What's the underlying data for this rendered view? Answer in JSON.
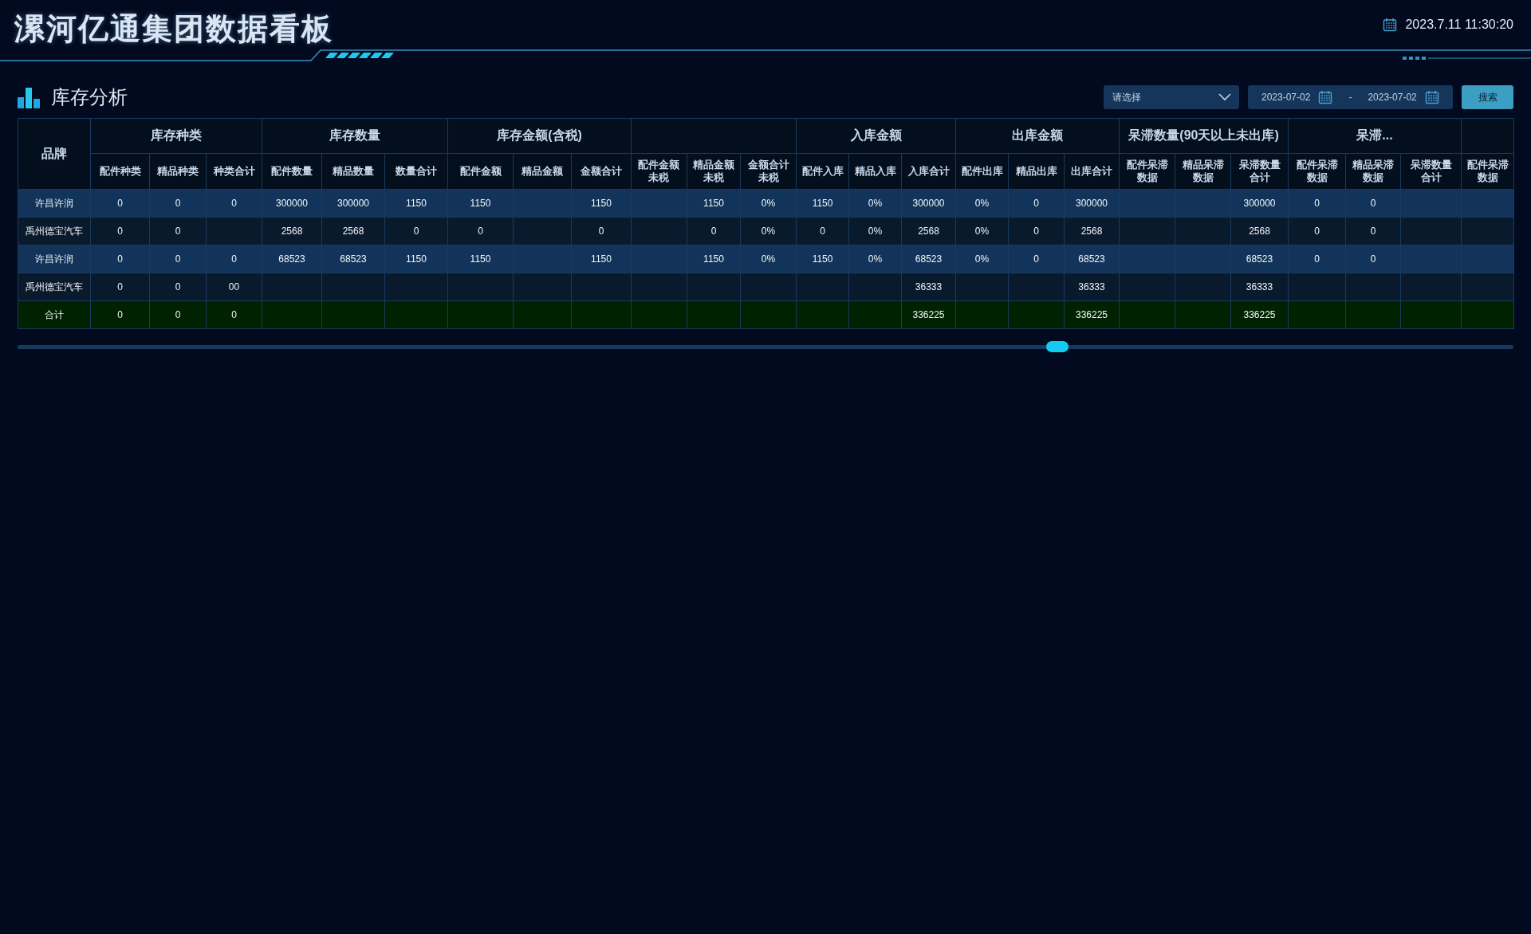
{
  "header": {
    "title": "漯河亿通集团数据看板",
    "datetime": "2023.7.11 11:30:20"
  },
  "section": {
    "title": "库存分析"
  },
  "filters": {
    "select": {
      "placeholder": "请选择"
    },
    "date_start": "2023-07-02",
    "date_separator": "-",
    "date_end": "2023-07-02",
    "search_button": "搜索"
  },
  "table": {
    "brand_header": "品牌",
    "groups": [
      {
        "label": "库存种类",
        "columns": [
          "配件种类",
          "精品种类",
          "种类合计"
        ]
      },
      {
        "label": "库存数量",
        "columns": [
          "配件数量",
          "精品数量",
          "数量合计"
        ]
      },
      {
        "label": "库存金额(含税)",
        "columns": [
          "配件金额",
          "精品金额",
          "金额合计"
        ]
      },
      {
        "columns": [
          "配件金额未税",
          "精品金额未税",
          "金额合计未税"
        ]
      },
      {
        "label": "入库金额",
        "columns": [
          "配件入库",
          "精品入库",
          "入库合计"
        ]
      },
      {
        "label": "出库金额",
        "columns": [
          "配件出库",
          "精品出库",
          "出库合计"
        ]
      },
      {
        "label": "呆滞数量(90天以上未出库)",
        "columns": [
          "配件呆滞数据",
          "精品呆滞数据",
          "呆滞数量合计"
        ]
      },
      {
        "label": "呆滞...",
        "columns": [
          "配件呆滞数据",
          "精品呆滞数据",
          "呆滞数量合计"
        ]
      },
      {
        "columns": [
          "配件呆滞数据"
        ]
      }
    ],
    "rows": [
      {
        "kind": "data",
        "cells": [
          "许昌许润",
          "0",
          "0",
          "0",
          "300000",
          "300000",
          "1150",
          "1150",
          "",
          "1150",
          "",
          "1150",
          "0%",
          "1150",
          "0%",
          "300000",
          "0%",
          "0",
          "300000",
          "",
          "",
          "300000",
          "0",
          "0",
          "",
          ""
        ]
      },
      {
        "kind": "data",
        "cells": [
          "禹州德宝汽车",
          "0",
          "0",
          "",
          "2568",
          "2568",
          "0",
          "0",
          "",
          "0",
          "",
          "0",
          "0%",
          "0",
          "0%",
          "2568",
          "0%",
          "0",
          "2568",
          "",
          "",
          "2568",
          "0",
          "0",
          "",
          ""
        ]
      },
      {
        "kind": "data",
        "cells": [
          "许昌许润",
          "0",
          "0",
          "0",
          "68523",
          "68523",
          "1150",
          "1150",
          "",
          "1150",
          "",
          "1150",
          "0%",
          "1150",
          "0%",
          "68523",
          "0%",
          "0",
          "68523",
          "",
          "",
          "68523",
          "0",
          "0",
          "",
          ""
        ]
      },
      {
        "kind": "data",
        "cells": [
          "禹州德宝汽车",
          "0",
          "0",
          "00",
          "",
          "",
          "",
          "",
          "",
          "",
          "",
          "",
          "",
          "",
          "",
          "36333",
          "",
          "",
          "36333",
          "",
          "",
          "36333",
          "",
          "",
          "",
          ""
        ]
      },
      {
        "kind": "total",
        "cells": [
          "合计",
          "0",
          "0",
          "0",
          "",
          "",
          "",
          "",
          "",
          "",
          "",
          "",
          "",
          "",
          "",
          "336225",
          "",
          "",
          "336225",
          "",
          "",
          "336225",
          "",
          "",
          "",
          ""
        ]
      }
    ]
  }
}
